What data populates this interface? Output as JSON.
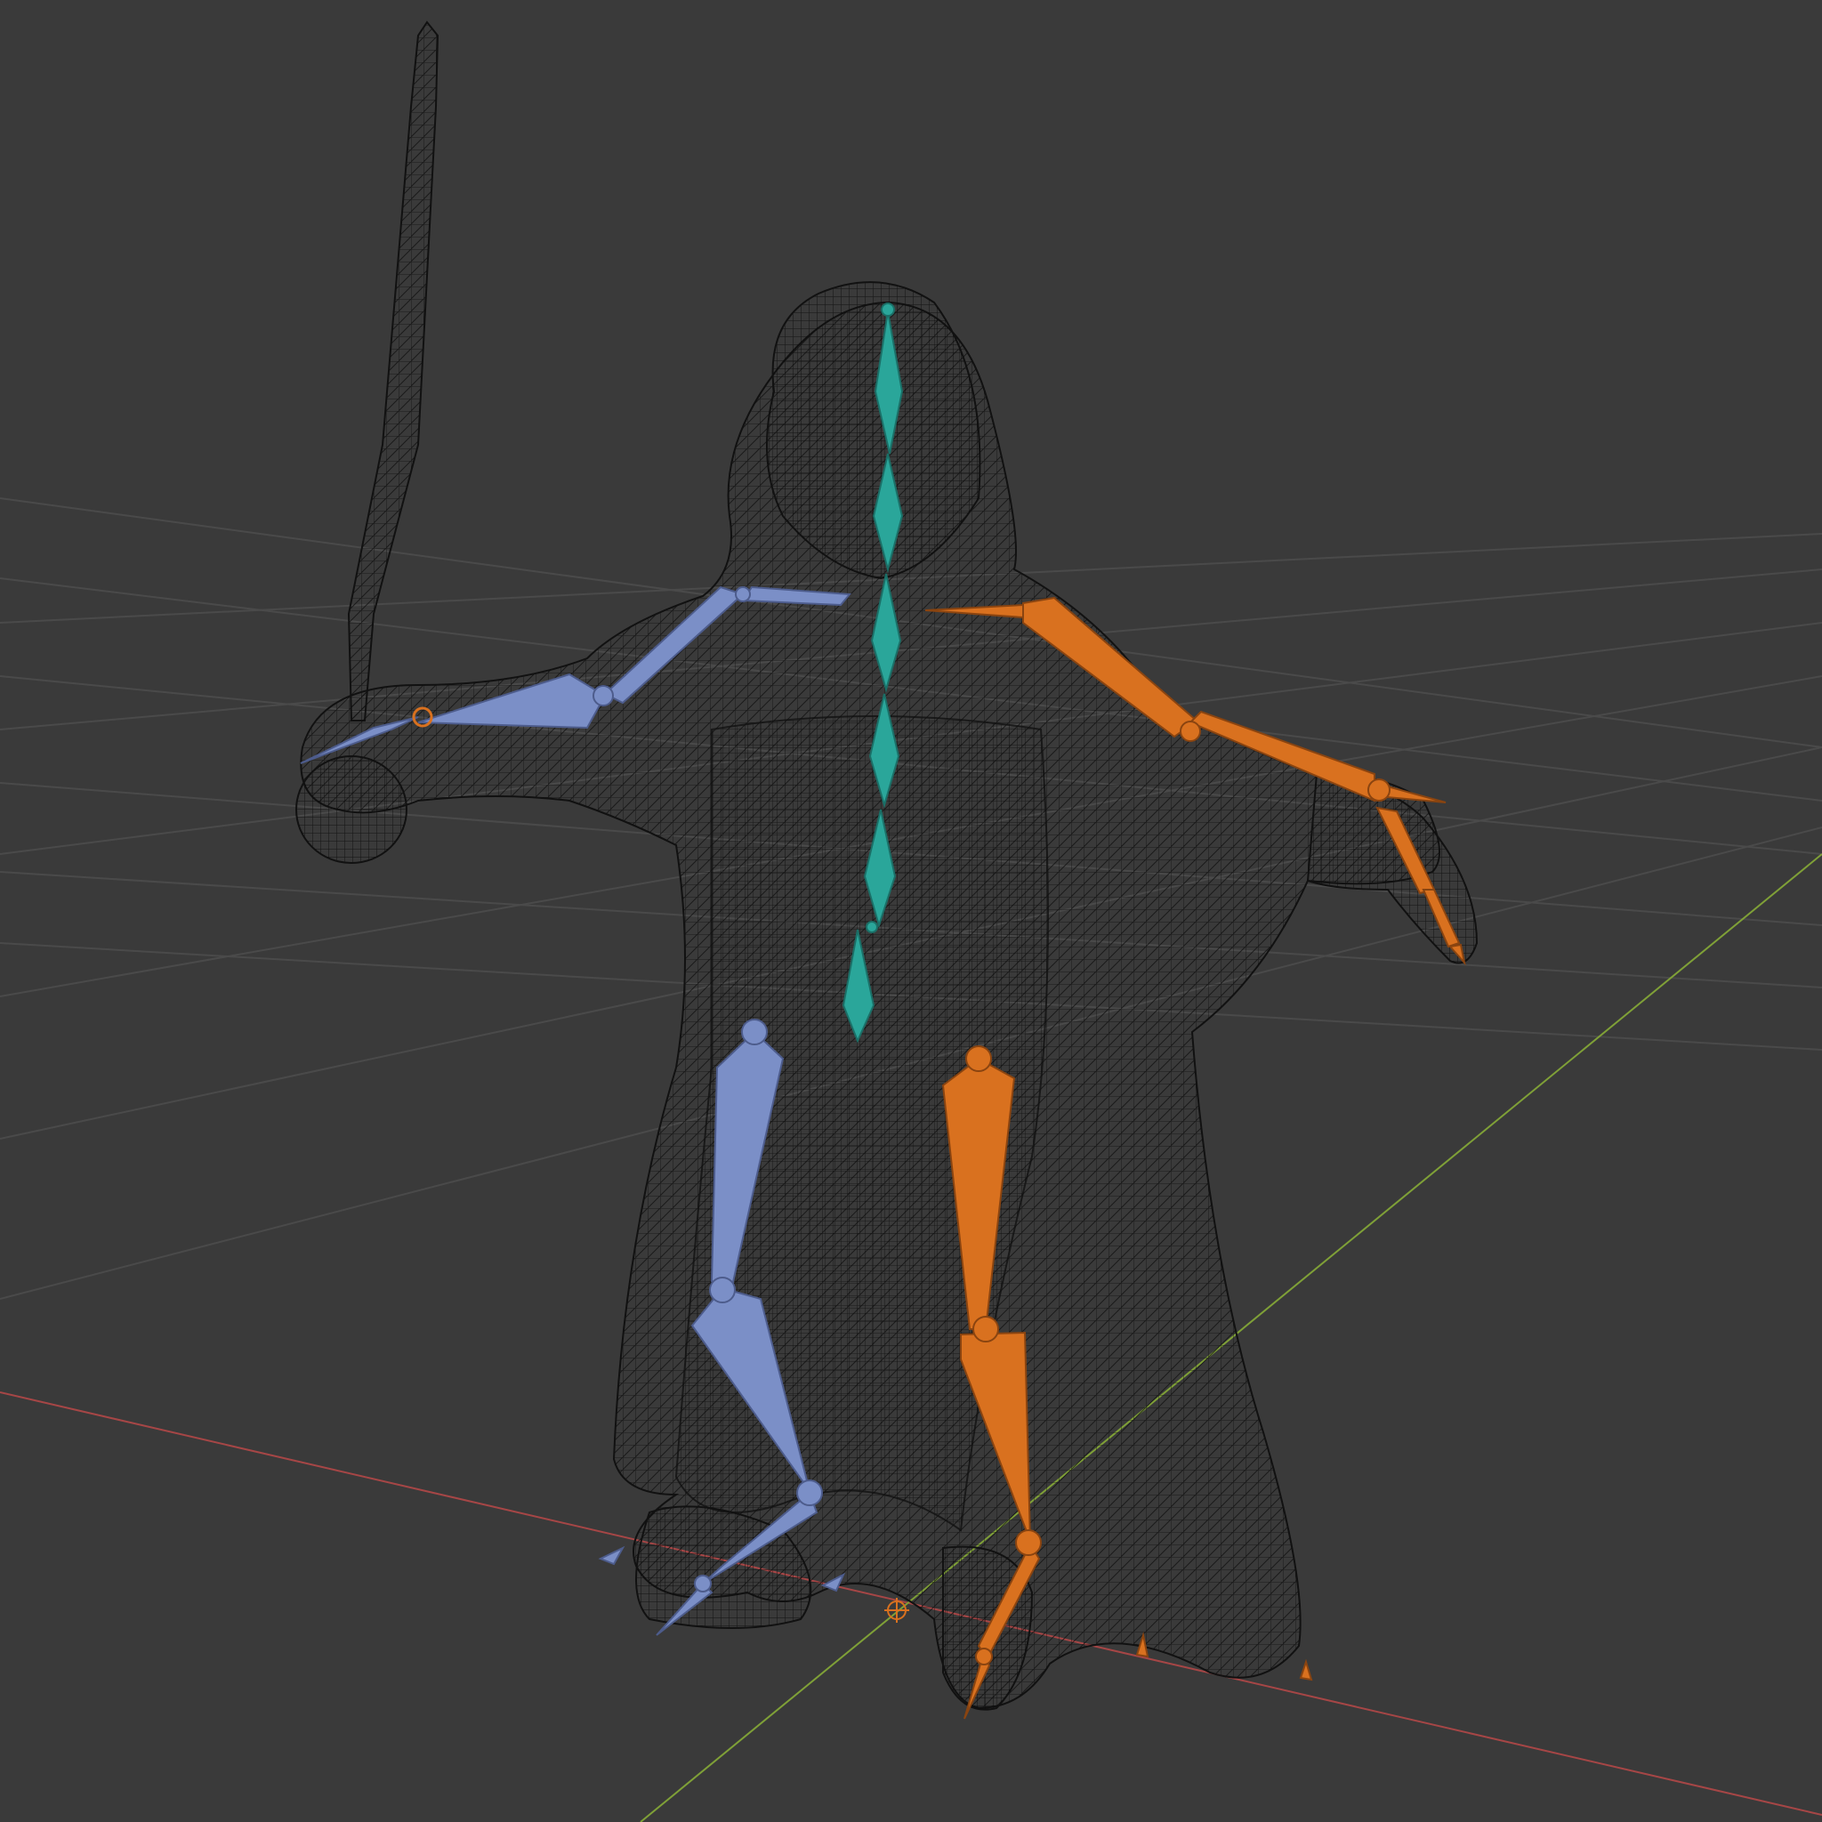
{
  "viewport": {
    "mode": "3D Viewport",
    "shading": "wireframe",
    "background_color": "#3a3a3a",
    "grid_color": "#4a4a4a",
    "x_axis_color": "#b34545",
    "y_axis_color": "#7fa037"
  },
  "objects": {
    "character_mesh": {
      "name": "hooded-cloaked-figure",
      "display": "wireframe",
      "wire_color": "#111111"
    },
    "sword_mesh": {
      "name": "sword",
      "display": "wireframe"
    },
    "armature": {
      "display": "octahedral",
      "colors": {
        "center": "#2aa69a",
        "left": "#7b8fc7",
        "right": "#d9711f"
      },
      "bone_groups": [
        "spine",
        "left-arm",
        "right-arm",
        "left-leg",
        "right-leg"
      ]
    }
  },
  "origin_marker": {
    "name": "3d-cursor"
  }
}
